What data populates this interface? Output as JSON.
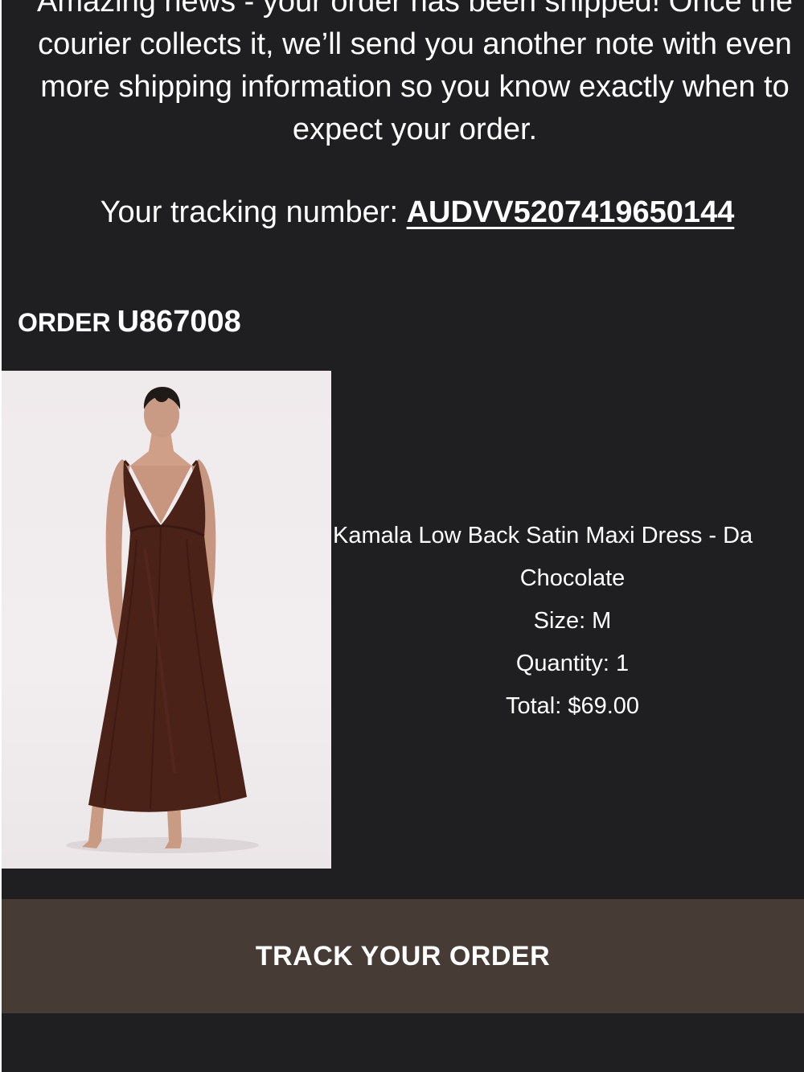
{
  "email": {
    "intro": "Amazing news - your order has been shipped! Once the courier collects it, we’ll send you another note with even more shipping information so you know exactly when to expect your order.",
    "tracking_label": "Your tracking number: ",
    "tracking_number": "AUDVV5207419650144"
  },
  "order": {
    "heading_label": "ORDER",
    "order_number": "U867008"
  },
  "product": {
    "image_icon": "product-photo-brown-satin-maxi-dress",
    "name": "Kamala Low Back Satin Maxi Dress - Da",
    "color": "Chocolate",
    "size": "Size: M",
    "quantity": "Quantity: 1",
    "total": "Total: $69.00"
  },
  "cta": {
    "label": "TRACK YOUR ORDER",
    "background": "#463b35"
  },
  "theme": {
    "background": "#1f1f22",
    "text": "#ffffff"
  }
}
